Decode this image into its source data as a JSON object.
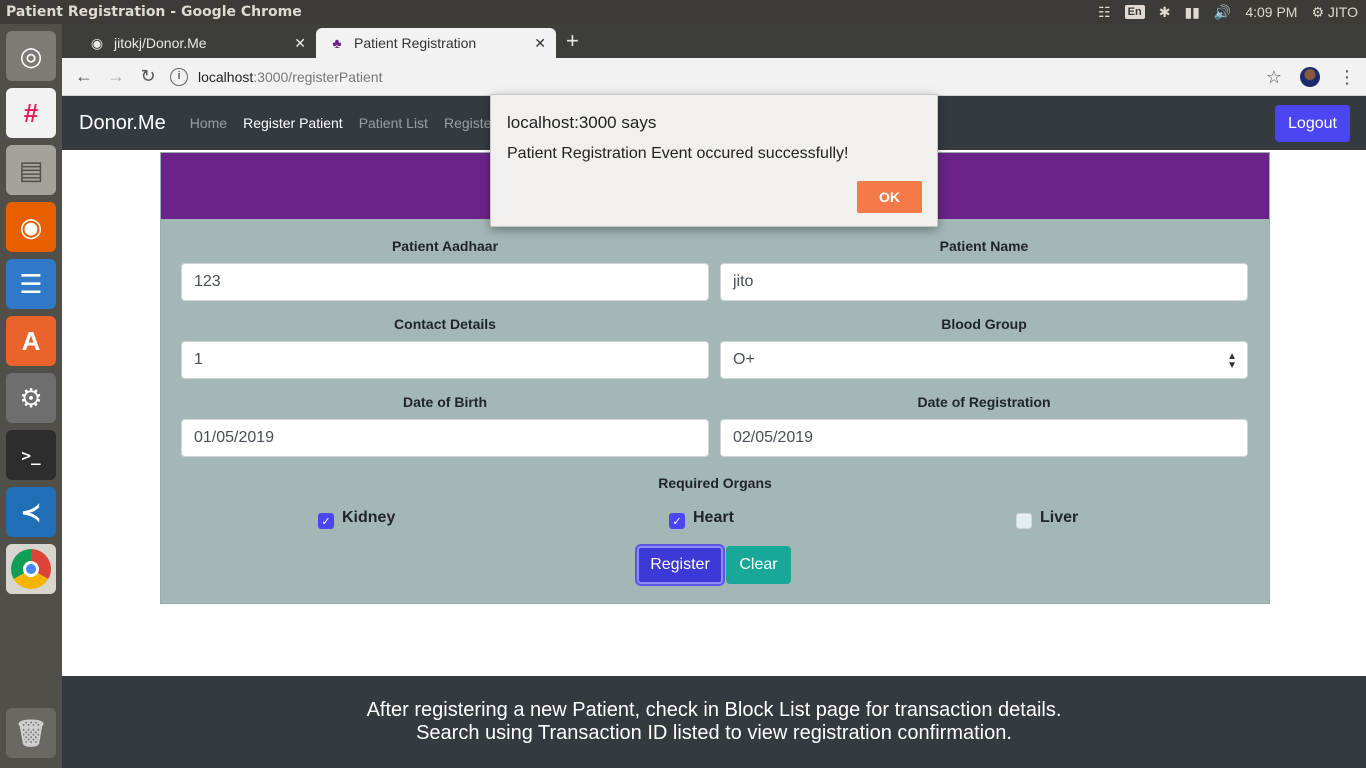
{
  "os": {
    "window_title": "Patient Registration - Google Chrome",
    "keyboard_layout": "En",
    "clock": "4:09 PM",
    "user": "JITO"
  },
  "launcher": {
    "items": [
      "ubuntu-dash",
      "slack",
      "files",
      "firefox",
      "libreoffice-writer",
      "software-center",
      "system-settings",
      "terminal",
      "vscode",
      "chrome",
      "trash"
    ]
  },
  "browser": {
    "tabs": [
      {
        "title": "jitokj/Donor.Me",
        "icon": "github-icon"
      },
      {
        "title": "Patient Registration",
        "icon": "app-icon"
      }
    ],
    "new_tab": "+",
    "url_host": "localhost",
    "url_path": ":3000/registerPatient"
  },
  "app": {
    "brand": "Donor.Me",
    "nav": [
      "Home",
      "Register Patient",
      "Patient List",
      "Registe"
    ],
    "logout": "Logout",
    "accent": "#4b45f2",
    "header_color": "#6a2488"
  },
  "form": {
    "aadhaar_label": "Patient Aadhaar",
    "aadhaar_value": "123",
    "name_label": "Patient Name",
    "name_value": "jito",
    "contact_label": "Contact Details",
    "contact_value": "1",
    "blood_label": "Blood Group",
    "blood_value": "O+",
    "dob_label": "Date of Birth",
    "dob_value": "01/05/2019",
    "dor_label": "Date of Registration",
    "dor_value": "02/05/2019",
    "organs_label": "Required Organs",
    "organs": [
      {
        "name": "Kidney",
        "checked": true
      },
      {
        "name": "Heart",
        "checked": true
      },
      {
        "name": "Liver",
        "checked": false
      }
    ],
    "register": "Register",
    "clear": "Clear"
  },
  "footer": {
    "line1": "After registering a new Patient, check in Block List page for transaction details.",
    "line2": "Search using Transaction ID listed to view registration confirmation."
  },
  "alert": {
    "title": "localhost:3000 says",
    "message": "Patient Registration Event occured successfully!",
    "ok": "OK"
  }
}
